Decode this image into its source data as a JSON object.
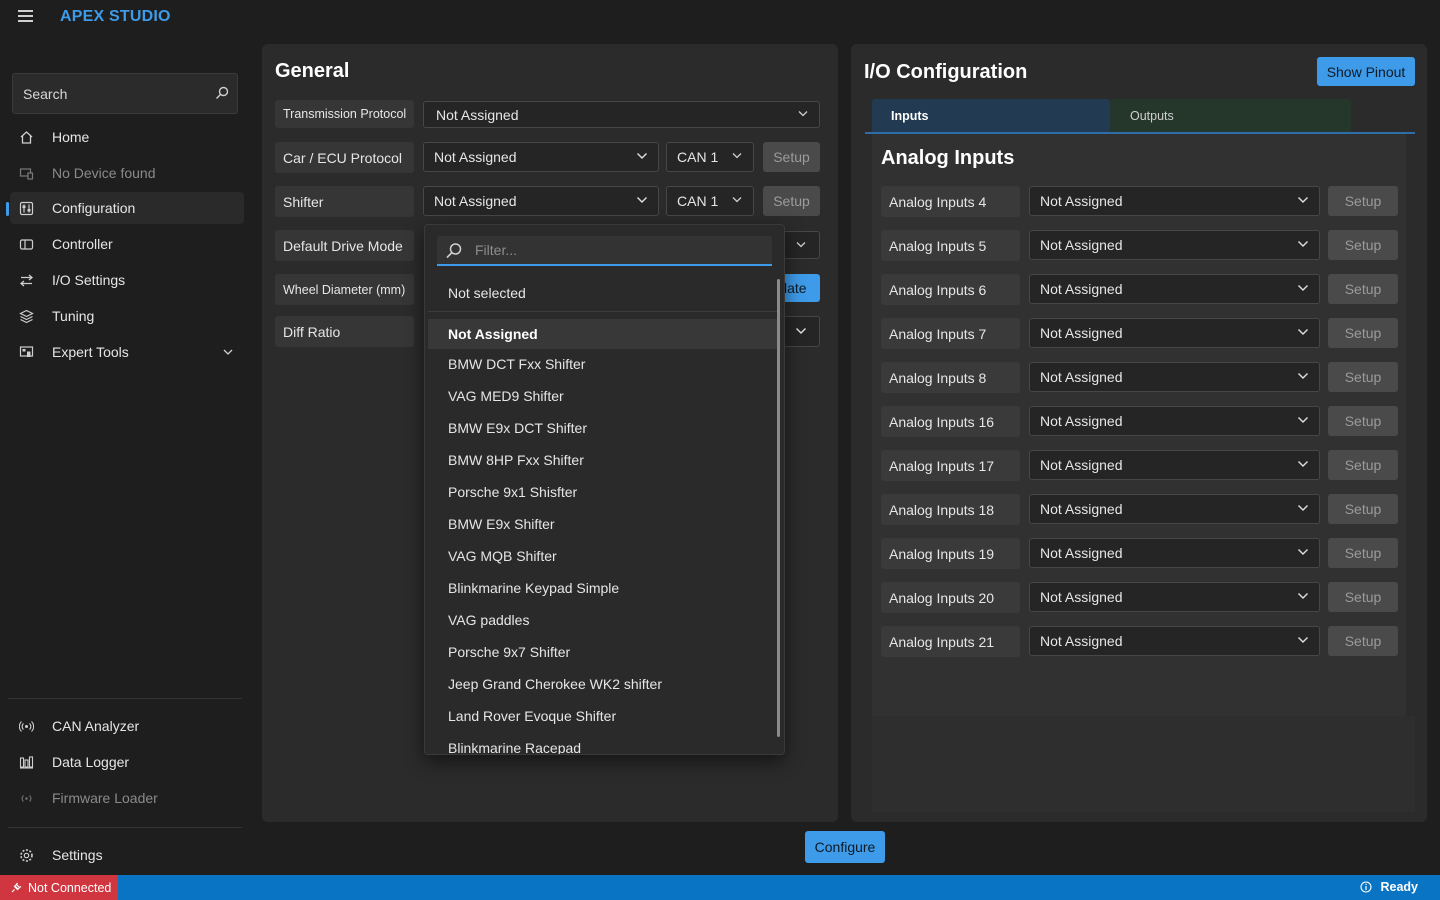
{
  "app": {
    "title": "APEX STUDIO"
  },
  "sidebar": {
    "search_placeholder": "Search",
    "items": [
      {
        "label": "Home",
        "icon": "home-icon",
        "disabled": false
      },
      {
        "label": "No Device found",
        "icon": "device-icon",
        "disabled": true
      },
      {
        "label": "Configuration",
        "icon": "configuration-icon",
        "active": true
      },
      {
        "label": "Controller",
        "icon": "controller-icon"
      },
      {
        "label": "I/O Settings",
        "icon": "io-arrows-icon"
      },
      {
        "label": "Tuning",
        "icon": "layers-icon"
      },
      {
        "label": "Expert Tools",
        "icon": "expert-tools-icon",
        "expandable": true
      }
    ],
    "bottom_items": [
      {
        "label": "CAN Analyzer",
        "icon": "broadcast-icon"
      },
      {
        "label": "Data Logger",
        "icon": "bar-chart-icon"
      },
      {
        "label": "Firmware Loader",
        "icon": "wireless-icon",
        "disabled": true
      }
    ],
    "settings": {
      "label": "Settings",
      "icon": "gear-icon"
    }
  },
  "general": {
    "title": "General",
    "fields": [
      {
        "label": "Transmission Protocol",
        "value": "Not Assigned"
      },
      {
        "label": "Car / ECU Protocol",
        "value": "Not Assigned",
        "can": "CAN 1",
        "button": "Setup"
      },
      {
        "label": "Shifter",
        "value": "Not Assigned",
        "can": "CAN 1",
        "button": "Setup"
      },
      {
        "label": "Default Drive Mode"
      },
      {
        "label": "Wheel Diameter (mm)",
        "button_partial": "late"
      },
      {
        "label": "Diff Ratio"
      }
    ]
  },
  "dropdown": {
    "filter_placeholder": "Filter...",
    "not_selected": "Not selected",
    "options": [
      "Not Assigned",
      "BMW DCT Fxx Shifter",
      "VAG MED9 Shifter",
      "BMW E9x DCT Shifter",
      "BMW 8HP Fxx Shifter",
      "Porsche 9x1 Shisfter",
      "BMW E9x Shifter",
      "VAG MQB Shifter",
      "Blinkmarine Keypad Simple",
      "VAG paddles",
      "Porsche 9x7 Shifter",
      "Jeep Grand Cherokee WK2 shifter",
      "Land Rover Evoque Shifter",
      "Blinkmarine Racepad"
    ],
    "selected": "Not Assigned"
  },
  "io": {
    "title": "I/O Configuration",
    "show_pinout": "Show Pinout",
    "tabs": [
      "Inputs",
      "Outputs"
    ],
    "active_tab": "Inputs",
    "section_title": "Analog Inputs",
    "rows": [
      {
        "label": "Analog Inputs 4",
        "value": "Not Assigned",
        "button": "Setup"
      },
      {
        "label": "Analog Inputs 5",
        "value": "Not Assigned",
        "button": "Setup"
      },
      {
        "label": "Analog Inputs 6",
        "value": "Not Assigned",
        "button": "Setup"
      },
      {
        "label": "Analog Inputs 7",
        "value": "Not Assigned",
        "button": "Setup"
      },
      {
        "label": "Analog Inputs 8",
        "value": "Not Assigned",
        "button": "Setup"
      },
      {
        "label": "Analog Inputs 16",
        "value": "Not Assigned",
        "button": "Setup"
      },
      {
        "label": "Analog Inputs 17",
        "value": "Not Assigned",
        "button": "Setup"
      },
      {
        "label": "Analog Inputs 18",
        "value": "Not Assigned",
        "button": "Setup"
      },
      {
        "label": "Analog Inputs 19",
        "value": "Not Assigned",
        "button": "Setup"
      },
      {
        "label": "Analog Inputs 20",
        "value": "Not Assigned",
        "button": "Setup"
      },
      {
        "label": "Analog Inputs 21",
        "value": "Not Assigned",
        "button": "Setup"
      }
    ]
  },
  "footer": {
    "configure": "Configure"
  },
  "status": {
    "connection": "Not Connected",
    "state": "Ready",
    "colors": {
      "bar": "#0a74c4",
      "disconnected": "#d0363f",
      "accent": "#3d9be9"
    }
  }
}
